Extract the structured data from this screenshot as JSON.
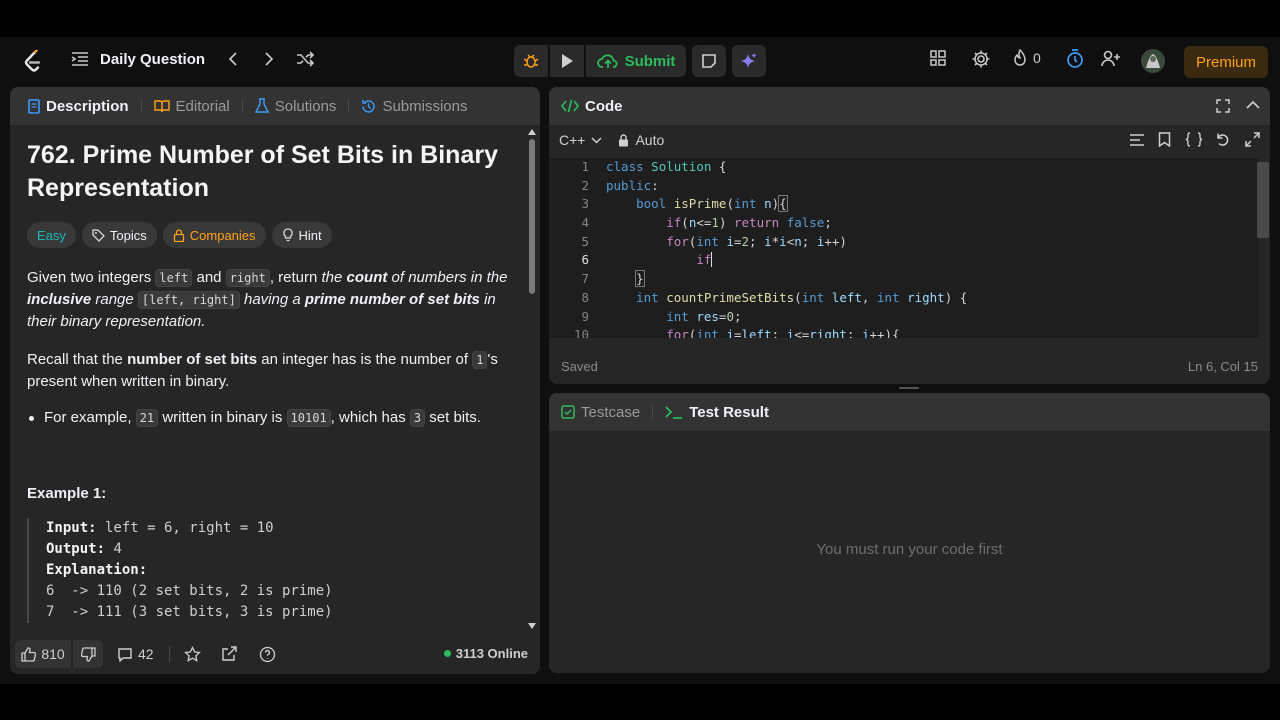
{
  "nav": {
    "title": "Daily Question",
    "submit_label": "Submit",
    "streak_count": "0",
    "premium_label": "Premium"
  },
  "left_tabs": [
    {
      "label": "Description"
    },
    {
      "label": "Editorial"
    },
    {
      "label": "Solutions"
    },
    {
      "label": "Submissions"
    }
  ],
  "problem": {
    "title": "762. Prime Number of Set Bits in Binary Representation",
    "tags": {
      "difficulty": "Easy",
      "topics": "Topics",
      "companies": "Companies",
      "hint": "Hint"
    },
    "p1": {
      "a": "Given two integers ",
      "code1": "left",
      "b": " and ",
      "code2": "right",
      "c": ", return ",
      "d": "the ",
      "e": "count",
      "f": " of numbers in the ",
      "g": "inclusive",
      "h": " range ",
      "code3": "[left, right]",
      "i": " having a ",
      "j": "prime number of set bits",
      "k": " in their binary representation."
    },
    "p2": {
      "a": "Recall that the ",
      "b": "number of set bits",
      "c": " an integer has is the number of ",
      "code1": "1",
      "d": "'s present when written in binary."
    },
    "bullet": {
      "a": "For example, ",
      "code1": "21",
      "b": " written in binary is ",
      "code2": "10101",
      "c": ", which has ",
      "code3": "3",
      "d": " set bits."
    },
    "example_title": "Example 1:",
    "example": {
      "input_label": "Input:",
      "input_value": " left = 6, right = 10",
      "output_label": "Output:",
      "output_value": " 4",
      "explanation_label": "Explanation:",
      "line1": "6  -> 110 (2 set bits, 2 is prime)",
      "line2": "7  -> 111 (3 set bits, 3 is prime)"
    }
  },
  "footer": {
    "likes": "810",
    "comments": "42",
    "online": "3113 Online"
  },
  "code_panel": {
    "title": "Code",
    "language": "C++",
    "mode": "Auto",
    "status": "Saved",
    "cursor_pos": "Ln 6, Col 15",
    "line_numbers": [
      "1",
      "2",
      "3",
      "4",
      "5",
      "6",
      "7",
      "8",
      "9",
      "10"
    ],
    "current_line": 6
  },
  "test_panel": {
    "tab_testcase": "Testcase",
    "tab_result": "Test Result",
    "empty_message": "You must run your code first"
  },
  "colors": {
    "accent_submit": "#2cbb5d",
    "premium": "#ffa116",
    "easy": "#1cb8b8"
  }
}
